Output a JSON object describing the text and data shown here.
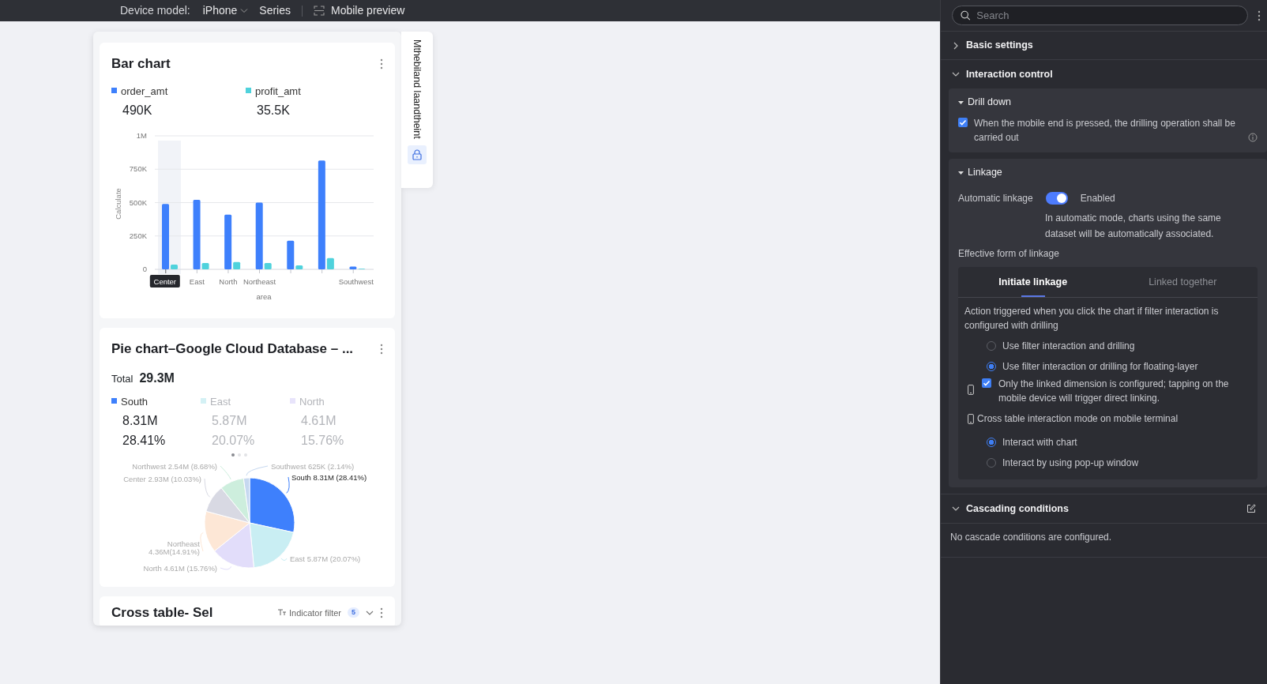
{
  "toolbar": {
    "device_label": "Device model:",
    "device": "iPhone",
    "series": "Series",
    "preview": "Mobile preview"
  },
  "side_tab": {
    "label": "Mthebiland laandtheint"
  },
  "bar_card": {
    "title": "Bar chart",
    "legend_values": [
      "490K",
      "35.5K"
    ],
    "category_states": [
      {
        "selected": true
      },
      {
        "selected": false
      },
      {
        "selected": false
      },
      {
        "selected": false
      },
      {
        "selected": false
      },
      {
        "selected": false
      },
      {
        "selected": false
      }
    ],
    "chart_data": {
      "type": "bar",
      "xlabel": "area",
      "ylabel": "Calculate",
      "categories": [
        "Center",
        "East",
        "North",
        "Northeast",
        null,
        null,
        "Southwest"
      ],
      "series": [
        {
          "name": "order_amt",
          "color": "#3e80fc",
          "values": [
            490000,
            520000,
            410000,
            500000,
            215000,
            815000,
            20000
          ]
        },
        {
          "name": "profit_amt",
          "color": "#4fd2dc",
          "values": [
            35000,
            48000,
            55000,
            48000,
            30000,
            85000,
            5000
          ]
        }
      ],
      "grid": true,
      "ylim": [
        0,
        1000000
      ],
      "yticks": [
        {
          "value": 0,
          "label": "0"
        },
        {
          "value": 250000,
          "label": "250K"
        },
        {
          "value": 500000,
          "label": "500K"
        },
        {
          "value": 750000,
          "label": "750K"
        },
        {
          "value": 1000000,
          "label": "1M"
        }
      ]
    }
  },
  "pie_card": {
    "title": "Pie chart–Google Cloud Database – ...",
    "total_label": "Total",
    "total": "29.3M",
    "legend": [
      {
        "name": "South",
        "value": "8.31M",
        "percent": "28.41%",
        "active": true
      },
      {
        "name": "East",
        "value": "5.87M",
        "percent": "20.07%",
        "active": false
      },
      {
        "name": "North",
        "value": "4.61M",
        "percent": "15.76%",
        "active": false
      }
    ],
    "pages": [
      {
        "selected": true
      },
      {
        "selected": false
      },
      {
        "selected": false
      }
    ],
    "chart_data": {
      "type": "pie",
      "categories": [
        "South",
        "East",
        "North",
        "Northeast",
        "Center",
        "Northwest",
        "Southwest"
      ],
      "values": [
        28.41,
        20.07,
        15.76,
        14.91,
        10.03,
        8.68,
        2.14
      ],
      "colors": [
        "#3e80fc",
        "#c9eef3",
        "#e2ddfa",
        "#fde7d6",
        "#d8d9e3",
        "#cdeedd",
        "#c6d8f0"
      ],
      "data_labels": true,
      "value_labels": [
        "8.31M (28.41%)",
        "5.87M (20.07%)",
        "4.61M (15.76%)",
        "4.36M(14.91%)",
        "2.93M (10.03%)",
        "2.54M (8.68%)",
        "625K (2.14%)"
      ]
    }
  },
  "table_card": {
    "title": "Cross table- Sel",
    "filter": "Indicator filter",
    "filter_count": "5"
  },
  "panel": {
    "search": {
      "placeholder": "Search"
    },
    "basic_settings": {
      "title": "Basic settings",
      "expanded": false
    },
    "interaction_control": {
      "title": "Interaction control",
      "expanded": true,
      "drill_down": {
        "title": "Drill down",
        "expanded": true,
        "label": "When the mobile end is pressed, the drilling operation shall be carried out",
        "checked": true
      },
      "linkage": {
        "title": "Linkage",
        "expanded": true,
        "auto_label": "Automatic linkage",
        "auto_on": true,
        "auto_state": "Enabled",
        "auto_hint": "In automatic mode, charts using the same dataset will be automatically associated.",
        "form_label": "Effective form of linkage",
        "tabs": [
          {
            "label": "Initiate linkage",
            "selected": true
          },
          {
            "label": "Linked together",
            "selected": false
          }
        ],
        "prompt": "Action triggered when you click the chart if filter interaction is configured with drilling",
        "options": [
          {
            "label": "Use filter interaction and drilling",
            "selected": false
          },
          {
            "label": "Use filter interaction or drilling for floating-layer",
            "selected": true
          }
        ],
        "sub_option": {
          "label": "Only the linked dimension is configured; tapping on the mobile device will trigger direct linking.",
          "checked": true
        },
        "cross_label": "Cross table interaction mode on mobile terminal",
        "cross_options": [
          {
            "label": "Interact with chart",
            "selected": true
          },
          {
            "label": "Interact by using pop-up window",
            "selected": false
          }
        ]
      }
    },
    "cascading": {
      "title": "Cascading conditions",
      "expanded": true,
      "empty_text": "No cascade conditions are configured."
    }
  }
}
